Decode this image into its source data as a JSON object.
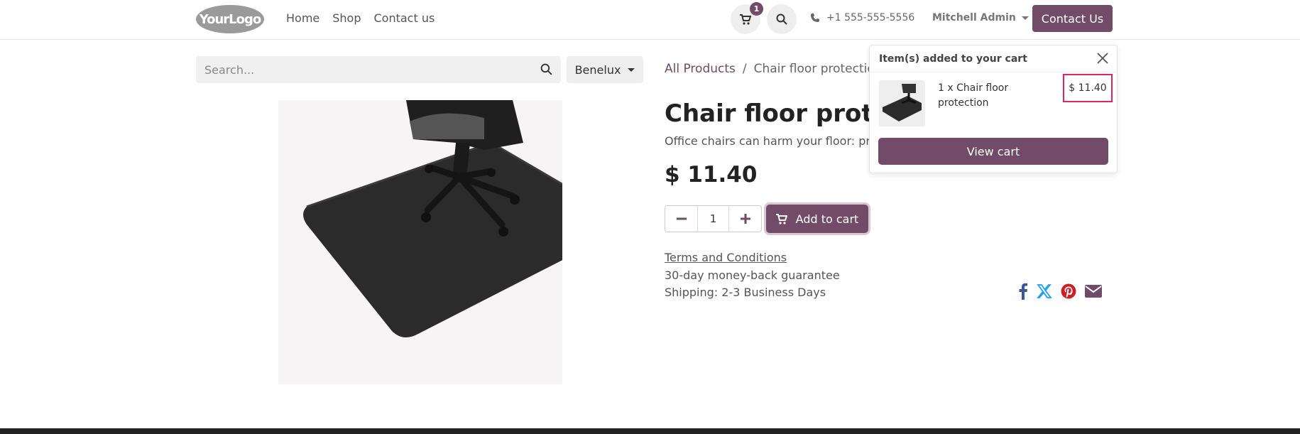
{
  "header": {
    "logo_text": "YourLogo",
    "nav": [
      "Home",
      "Shop",
      "Contact us"
    ],
    "cart_count": "1",
    "phone": "+1 555-555-5556",
    "user": "Mitchell Admin",
    "contact_button": "Contact Us"
  },
  "search": {
    "placeholder": "Search...",
    "pricelist": "Benelux"
  },
  "breadcrumb": {
    "root": "All Products",
    "separator": "/",
    "current": "Chair floor protection"
  },
  "product": {
    "title": "Chair floor protection",
    "description": "Office chairs can harm your floor: protect it.",
    "price": "$ 11.40",
    "quantity": "1",
    "add_to_cart": "Add to cart",
    "terms": "Terms and Conditions",
    "guarantee": "30-day money-back guarantee",
    "shipping": "Shipping: 2-3 Business Days"
  },
  "cart_popover": {
    "heading": "Item(s) added to your cart",
    "item_name": "1 x Chair floor protection",
    "item_price": "$ 11.40",
    "view_cart": "View cart"
  },
  "colors": {
    "brand": "#714b67",
    "highlight": "#e0245e"
  },
  "share_icons": [
    "facebook-icon",
    "x-twitter-icon",
    "pinterest-icon",
    "email-icon"
  ]
}
